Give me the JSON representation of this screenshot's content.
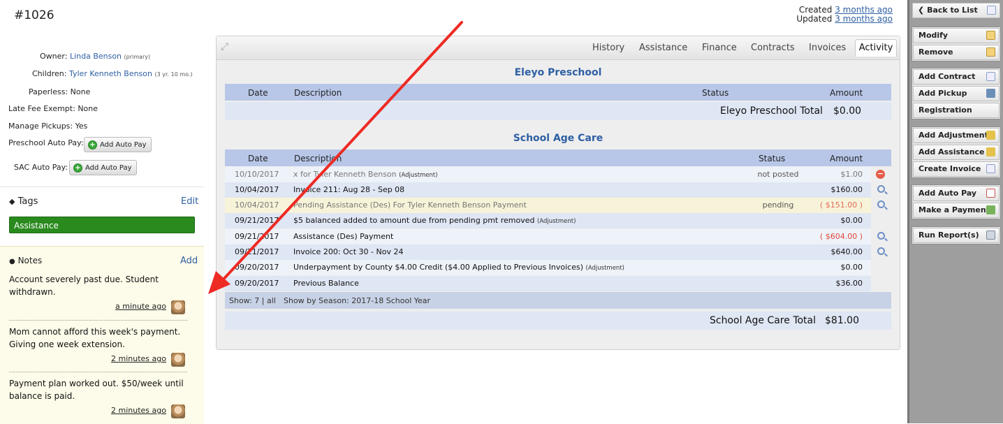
{
  "header": {
    "record_id": "#1026",
    "created_label": "Created",
    "created_value": "3 months ago",
    "updated_label": "Updated",
    "updated_value": "3 months ago"
  },
  "info": {
    "owner_label": "Owner:",
    "owner_name": "Linda Benson",
    "owner_note": "(primary)",
    "children_label": "Children:",
    "child_name": "Tyler Kenneth Benson",
    "child_age": "(3 yr. 10 mo.)",
    "paperless_label": "Paperless:",
    "paperless_value": "None",
    "late_fee_label": "Late Fee Exempt:",
    "late_fee_value": "None",
    "pickups_label": "Manage Pickups:",
    "pickups_value": "Yes",
    "preschool_autopay_label": "Preschool Auto Pay:",
    "sac_autopay_label": "SAC Auto Pay:",
    "add_autopay_button": "Add Auto Pay"
  },
  "tags": {
    "title": "Tags",
    "edit": "Edit",
    "items": [
      "Assistance"
    ]
  },
  "notes": {
    "title": "Notes",
    "add": "Add",
    "items": [
      {
        "line1": "Account severely past due. Student",
        "line2": "withdrawn.",
        "time": "a minute ago"
      },
      {
        "line1": "Mom cannot afford this week's payment.",
        "line2": "Giving one week extension.",
        "time": "2 minutes ago"
      },
      {
        "line1": "Payment plan worked out. $50/week until",
        "line2": "balance is paid.",
        "time": "2 minutes ago"
      }
    ]
  },
  "tabs": [
    "History",
    "Assistance",
    "Finance",
    "Contracts",
    "Invoices",
    "Activity"
  ],
  "active_tab": "Activity",
  "preschool": {
    "title": "Eleyo Preschool",
    "col_date": "Date",
    "col_desc": "Description",
    "col_status": "Status",
    "col_amount": "Amount",
    "total_label": "Eleyo Preschool Total",
    "total_value": "$0.00"
  },
  "sac": {
    "title": "School Age Care",
    "col_date": "Date",
    "col_desc": "Description",
    "col_status": "Status",
    "col_amount": "Amount",
    "rows": [
      {
        "date": "10/10/2017",
        "desc": "x for Tyler Kenneth Benson",
        "tag": "(Adjustment)",
        "status": "not posted",
        "amount": "$1.00"
      },
      {
        "date": "10/04/2017",
        "desc": "Invoice 211: Aug 28 - Sep 08",
        "tag": "",
        "status": "",
        "amount": "$160.00"
      },
      {
        "date": "10/04/2017",
        "desc": "Pending Assistance (Des) For Tyler Kenneth Benson Payment",
        "tag": "",
        "status": "pending",
        "amount": "( $151.00 )"
      },
      {
        "date": "09/21/2017",
        "desc": "$5 balanced added to amount due from pending pmt removed",
        "tag": "(Adjustment)",
        "status": "",
        "amount": "$0.00"
      },
      {
        "date": "09/21/2017",
        "desc": "Assistance (Des) Payment",
        "tag": "",
        "status": "",
        "amount": "( $604.00 )"
      },
      {
        "date": "09/21/2017",
        "desc": "Invoice 200: Oct 30 - Nov 24",
        "tag": "",
        "status": "",
        "amount": "$640.00"
      },
      {
        "date": "09/20/2017",
        "desc": "Underpayment by County $4.00 Credit ($4.00 Applied to Previous Invoices)",
        "tag": "(Adjustment)",
        "status": "",
        "amount": "$0.00"
      },
      {
        "date": "09/20/2017",
        "desc": "Previous Balance",
        "tag": "",
        "status": "",
        "amount": "$36.00"
      }
    ],
    "footer_show": "Show:",
    "footer_count": "7",
    "footer_sep": "|",
    "footer_all": "all",
    "footer_season_label": "Show by Season:",
    "footer_season": "2017-18 School Year",
    "total_label": "School Age Care Total",
    "total_value": "$81.00"
  },
  "sidebar": {
    "back": "Back to List",
    "modify": "Modify",
    "remove": "Remove",
    "add_contract": "Add Contract",
    "add_pickup": "Add Pickup",
    "registration": "Registration",
    "add_adjustment": "Add Adjustment",
    "add_assistance": "Add Assistance",
    "create_invoice": "Create Invoice",
    "add_auto_pay": "Add Auto Pay",
    "make_payment": "Make a Payment",
    "run_reports": "Run Report(s)"
  },
  "colors": {
    "link": "#2e5fa3",
    "tag_green": "#2a8a1e",
    "arrow_red": "#ee2a24",
    "negative": "#e0473a"
  }
}
